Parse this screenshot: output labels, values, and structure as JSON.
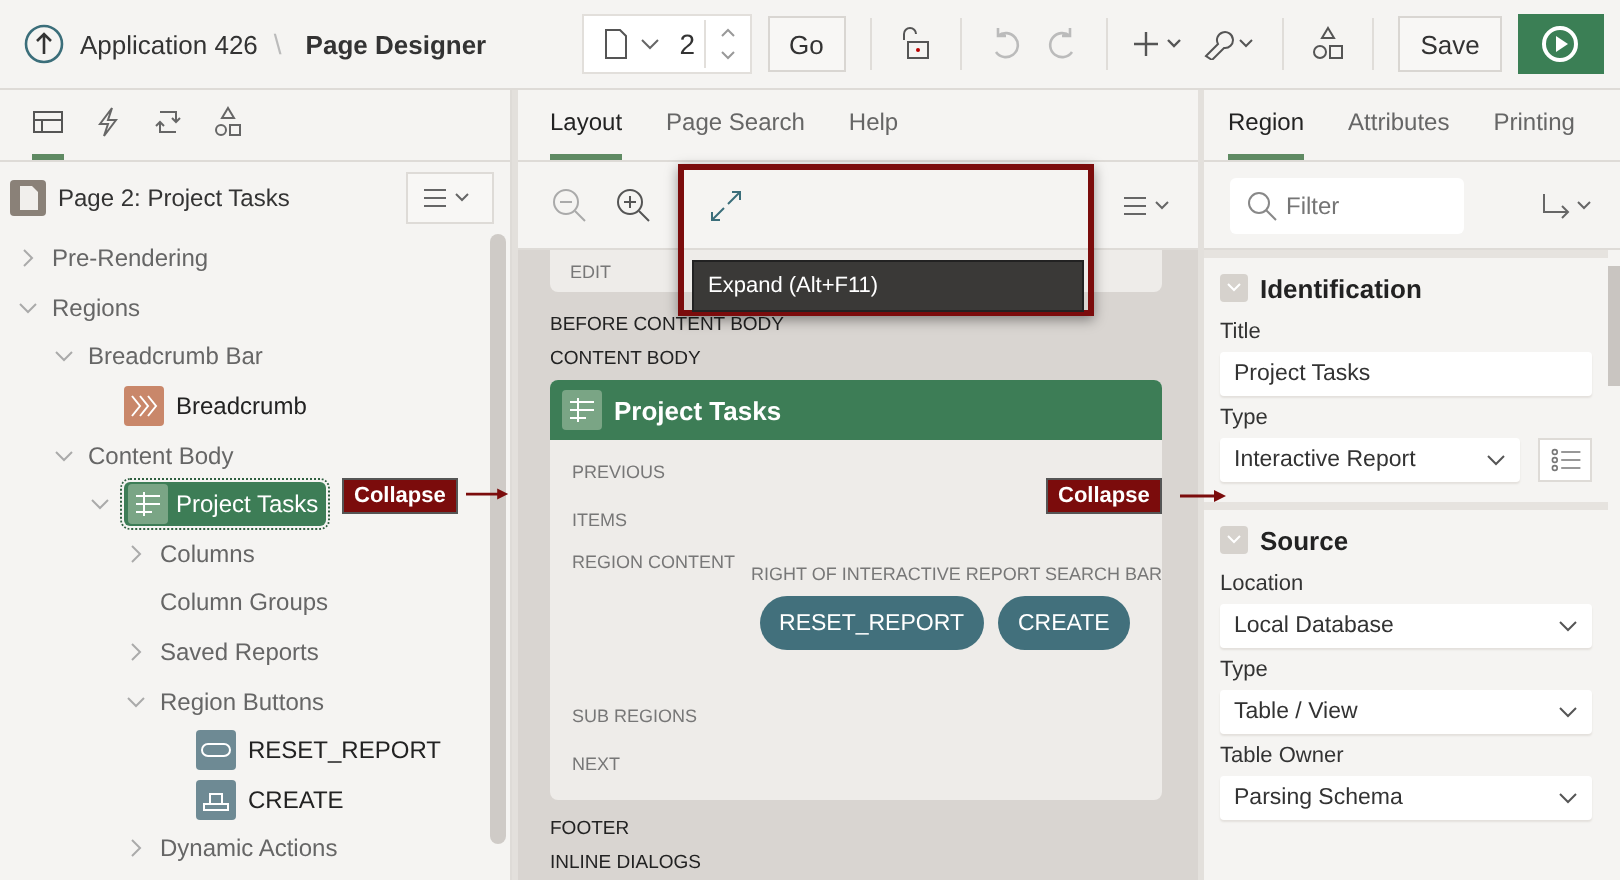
{
  "header": {
    "app": "Application 426",
    "separator": "\\",
    "title": "Page Designer",
    "page_number": "2",
    "go": "Go",
    "save": "Save"
  },
  "left_tabs": [
    {
      "kind": "rendering",
      "selected": true
    },
    {
      "kind": "dynamic-actions",
      "selected": false
    },
    {
      "kind": "processing",
      "selected": false
    },
    {
      "kind": "shared",
      "selected": false
    }
  ],
  "tree_title": "Page 2: Project Tasks",
  "tree": [
    {
      "label": "Pre-Rendering",
      "kind": "folder",
      "expanded": false,
      "selected": false
    },
    {
      "label": "Regions",
      "kind": "folder",
      "expanded": true,
      "selected": false,
      "children": [
        {
          "label": "Breadcrumb Bar",
          "kind": "folder",
          "expanded": true,
          "selected": false,
          "children": [
            {
              "label": "Breadcrumb",
              "kind": "breadcrumb",
              "selected": false
            }
          ]
        },
        {
          "label": "Content Body",
          "kind": "folder",
          "expanded": true,
          "selected": false,
          "children": [
            {
              "label": "Project Tasks",
              "kind": "report",
              "expanded": true,
              "selected": true,
              "children": [
                {
                  "label": "Columns",
                  "kind": "folder",
                  "expanded": false,
                  "selected": false
                },
                {
                  "label": "Column Groups",
                  "kind": "folder",
                  "selected": false
                },
                {
                  "label": "Saved Reports",
                  "kind": "folder",
                  "expanded": false,
                  "selected": false
                },
                {
                  "label": "Region Buttons",
                  "kind": "folder",
                  "expanded": true,
                  "selected": false,
                  "children": [
                    {
                      "label": "RESET_REPORT",
                      "kind": "button",
                      "selected": false
                    },
                    {
                      "label": "CREATE",
                      "kind": "create",
                      "selected": false
                    }
                  ]
                },
                {
                  "label": "Dynamic Actions",
                  "kind": "folder",
                  "expanded": false,
                  "selected": false
                }
              ]
            }
          ]
        }
      ]
    }
  ],
  "center_tabs": [
    {
      "label": "Layout",
      "selected": true
    },
    {
      "label": "Page Search",
      "selected": false
    },
    {
      "label": "Help",
      "selected": false
    }
  ],
  "tooltip": "Expand (Alt+F11)",
  "layout": {
    "top_card": [
      "EDIT"
    ],
    "before": [
      "BEFORE CONTENT BODY",
      "CONTENT BODY"
    ],
    "region_title": "Project Tasks",
    "slots_top": [
      "PREVIOUS",
      "ITEMS"
    ],
    "region_content": "REGION CONTENT",
    "search_bar_label": "RIGHT OF INTERACTIVE REPORT SEARCH BAR",
    "buttons": [
      "RESET_REPORT",
      "CREATE"
    ],
    "slots_bottom": [
      "SUB REGIONS",
      "NEXT"
    ],
    "after": [
      "FOOTER",
      "INLINE DIALOGS"
    ]
  },
  "right_tabs": [
    {
      "label": "Region",
      "selected": true
    },
    {
      "label": "Attributes",
      "selected": false
    },
    {
      "label": "Printing",
      "selected": false
    }
  ],
  "filter": {
    "placeholder": "Filter"
  },
  "sections": [
    {
      "title": "Identification",
      "fields": [
        {
          "label": "Title",
          "value": "Project Tasks",
          "kind": "text"
        },
        {
          "label": "Type",
          "value": "Interactive Report",
          "kind": "select-extra"
        }
      ]
    },
    {
      "title": "Source",
      "fields": [
        {
          "label": "Location",
          "value": "Local Database",
          "kind": "select"
        },
        {
          "label": "Type",
          "value": "Table / View",
          "kind": "select"
        },
        {
          "label": "Table Owner",
          "value": "Parsing Schema",
          "kind": "select"
        }
      ]
    }
  ],
  "callouts": [
    {
      "label": "Collapse"
    },
    {
      "label": "Collapse"
    }
  ]
}
